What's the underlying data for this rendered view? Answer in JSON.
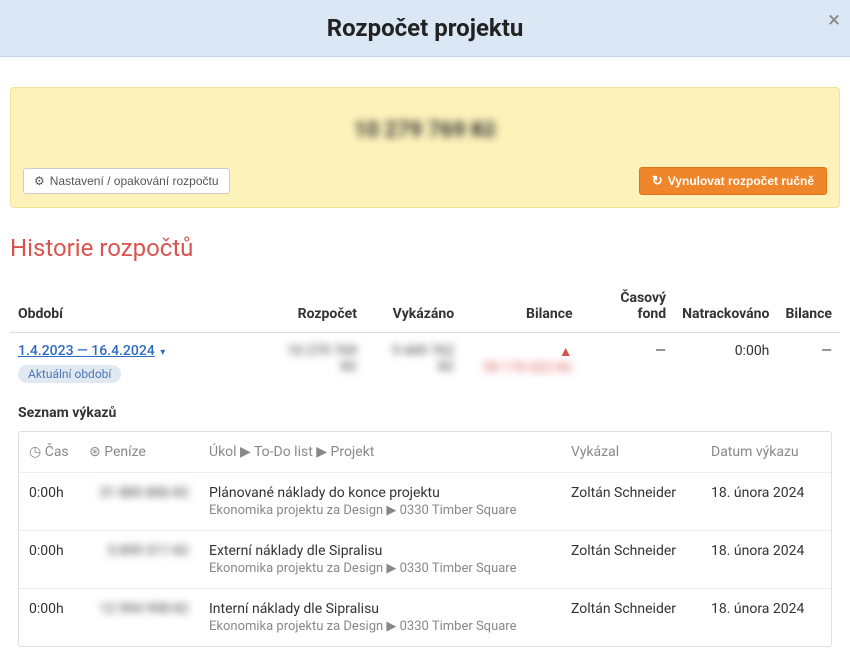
{
  "modal": {
    "title": "Rozpočet projektu",
    "close": "×"
  },
  "budget_panel": {
    "amount": "10 279 769 Kč",
    "settings_btn": "Nastavení / opakování rozpočtu",
    "reset_btn": "Vynulovat rozpočet ručně"
  },
  "history": {
    "title": "Historie rozpočtů",
    "columns": {
      "period": "Období",
      "budget": "Rozpočet",
      "reported": "Vykázáno",
      "balance": "Bilance",
      "time_fund": "Časový fond",
      "tracked": "Natrackováno",
      "balance2": "Bilance"
    },
    "row": {
      "period": "1.4.2023 — 16.4.2024",
      "badge": "Aktuální období",
      "budget": "10 279 769 Kč",
      "reported": "9 449 762 Kč",
      "balance_icon": "▲",
      "balance": "59 170 022 Kč",
      "time_fund": "—",
      "tracked": "0:00h",
      "balance2": "—"
    }
  },
  "records": {
    "heading": "Seznam výkazů",
    "columns": {
      "time": "Čas",
      "money": "Peníze",
      "task": "Úkol ▶ To-Do list ▶ Projekt",
      "reported_by": "Vykázal",
      "date": "Datum výkazu"
    },
    "items": [
      {
        "time": "0:00h",
        "money": "31 885 806 Kč",
        "title": "Plánované náklady do konce projektu",
        "path": "Ekonomika projektu za Design ▶ 0330 Timber Square",
        "by": "Zoltán Schneider",
        "date": "18. února 2024"
      },
      {
        "time": "0:00h",
        "money": "5 899 511 Kč",
        "title": "Externí náklady dle Sipralisu",
        "path": "Ekonomika projektu za Design ▶ 0330 Timber Square",
        "by": "Zoltán Schneider",
        "date": "18. února 2024"
      },
      {
        "time": "0:00h",
        "money": "12 994 998 Kč",
        "title": "Interní náklady dle Sipralisu",
        "path": "Ekonomika projektu za Design ▶ 0330 Timber Square",
        "by": "Zoltán Schneider",
        "date": "18. února 2024"
      }
    ]
  },
  "icons": {
    "clock": "◷",
    "coin": "⊛"
  }
}
